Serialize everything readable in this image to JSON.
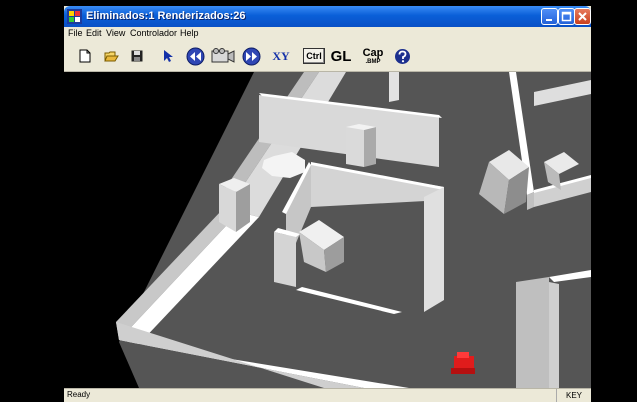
{
  "window": {
    "title": "Eliminados:1  Renderizados:26"
  },
  "menu": [
    {
      "label": "File"
    },
    {
      "label": "Edit"
    },
    {
      "label": "View"
    },
    {
      "label": "Controlador"
    },
    {
      "label": "Help"
    }
  ],
  "toolbar": {
    "new_icon": "new-document-icon",
    "open_icon": "open-folder-icon",
    "save_icon": "save-disk-icon",
    "pointer_icon": "arrow-pointer-icon",
    "rewind_icon": "rewind-icon",
    "camera_icon": "camera-icon",
    "forward_icon": "fast-forward-icon",
    "xy_label": "XY",
    "ctrl_label": "Ctrl",
    "gl_label": "GL",
    "cap_label": "Cap",
    "cap_sub": ".BMP",
    "help_icon": "context-help-icon"
  },
  "status": {
    "text": "Ready",
    "key": "KEY"
  },
  "colors": {
    "floor": "#555555",
    "wall": "#dadada",
    "robot": "#e01c1c",
    "titlebar": "#0a5fd8"
  }
}
